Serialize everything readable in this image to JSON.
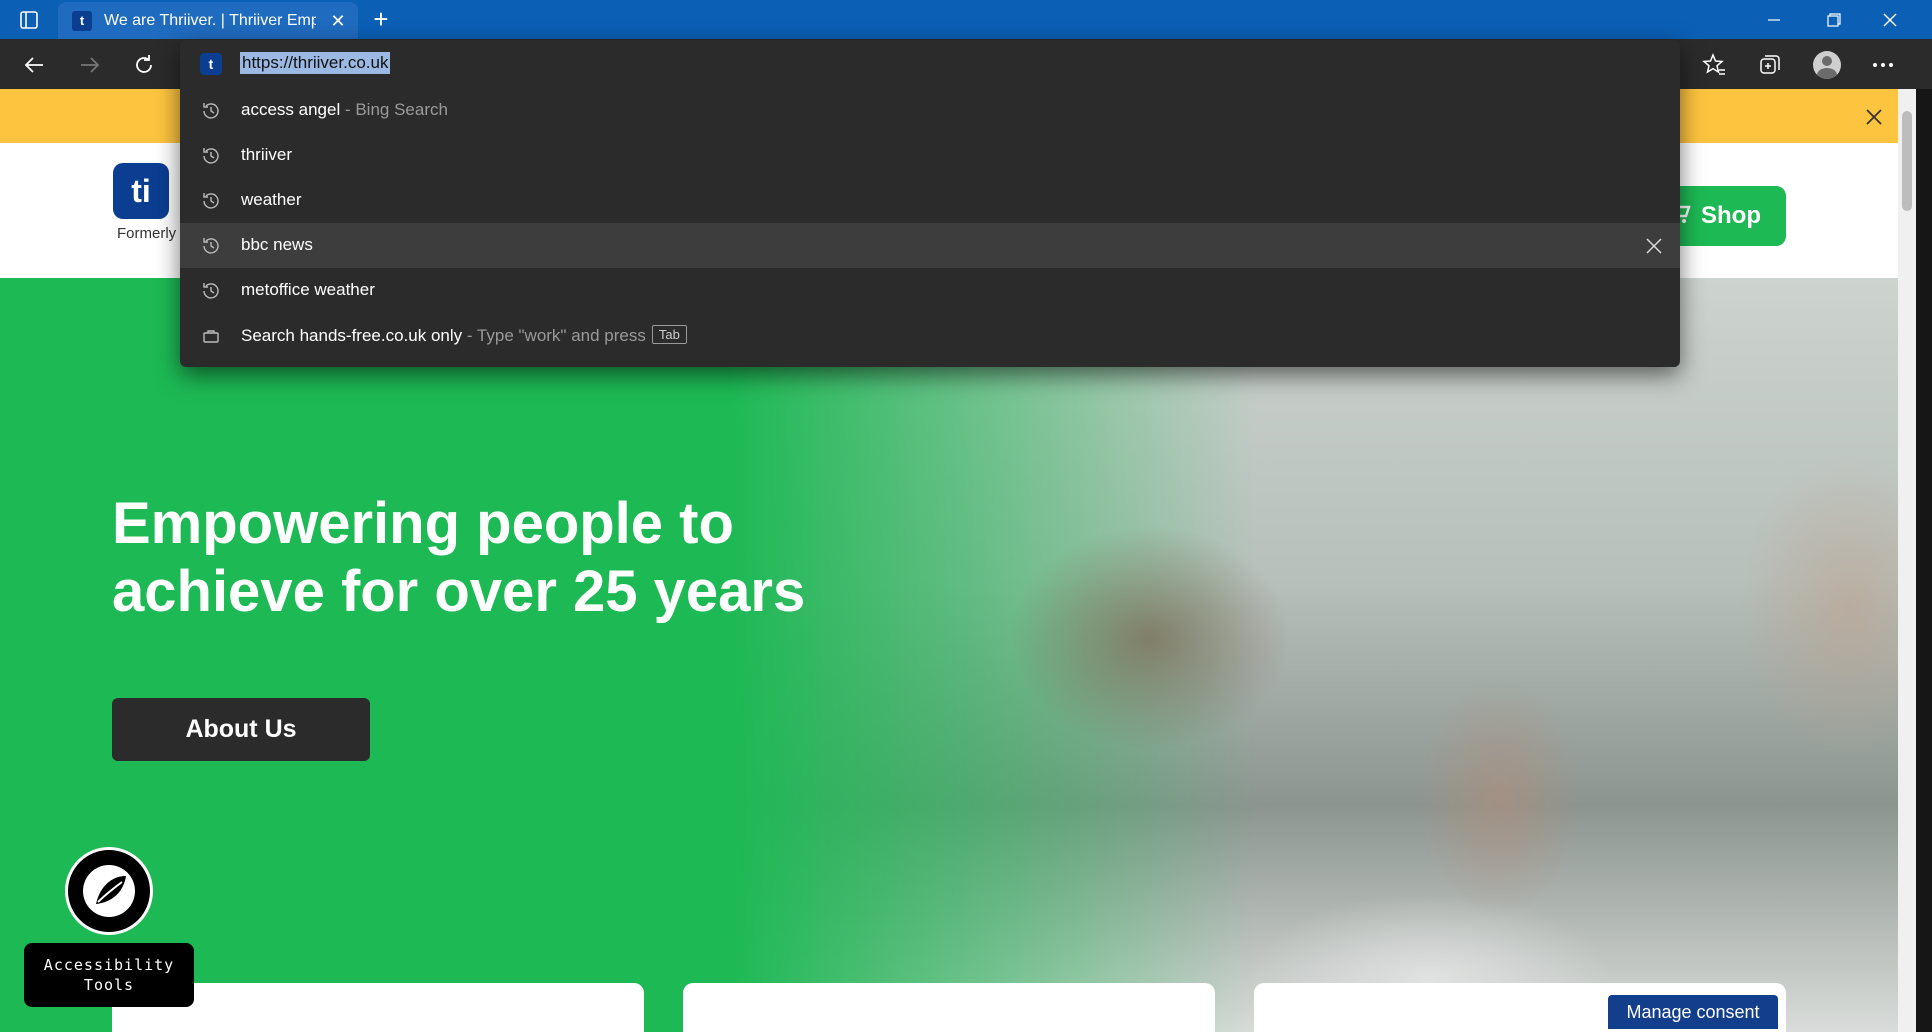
{
  "browser": {
    "tab": {
      "title": "We are Thriiver. | Thriiver Employ",
      "favicon": "thriiver-favicon"
    },
    "icons": {
      "tab_actions": "tab-actions-icon",
      "back": "back-arrow-icon",
      "forward": "forward-arrow-icon",
      "refresh": "refresh-icon",
      "favorites": "favorites-star-icon",
      "collections": "collections-icon",
      "profile": "profile-avatar-icon",
      "more": "more-dots-icon"
    }
  },
  "omnibox": {
    "url": "https://thriiver.co.uk",
    "suggestions": [
      {
        "text": "access angel",
        "sub": " - Bing Search",
        "icon": "history-icon"
      },
      {
        "text": "thriiver",
        "sub": "",
        "icon": "history-icon"
      },
      {
        "text": "weather",
        "sub": "",
        "icon": "history-icon"
      },
      {
        "text": "bbc news",
        "sub": "",
        "icon": "history-icon"
      },
      {
        "text": "metoffice weather",
        "sub": "",
        "icon": "history-icon"
      },
      {
        "text": "Search hands-free.co.uk only",
        "sub": " - Type \"work\" and press",
        "key": "Tab",
        "icon": "briefcase-icon"
      }
    ]
  },
  "page": {
    "logo_sub": "Formerly",
    "shop_label": "Shop",
    "hero": {
      "heading": "Empowering people to achieve for over 25 years",
      "button": "About Us"
    },
    "accessibility_label": "Accessibility Tools",
    "consent_label": "Manage consent"
  },
  "colors": {
    "brand_green": "#1db954",
    "brand_blue": "#0b3d91",
    "banner_yellow": "#fdc43f",
    "chrome_blue": "#0b5fb5",
    "toolbar_dark": "#2b2b2b"
  }
}
